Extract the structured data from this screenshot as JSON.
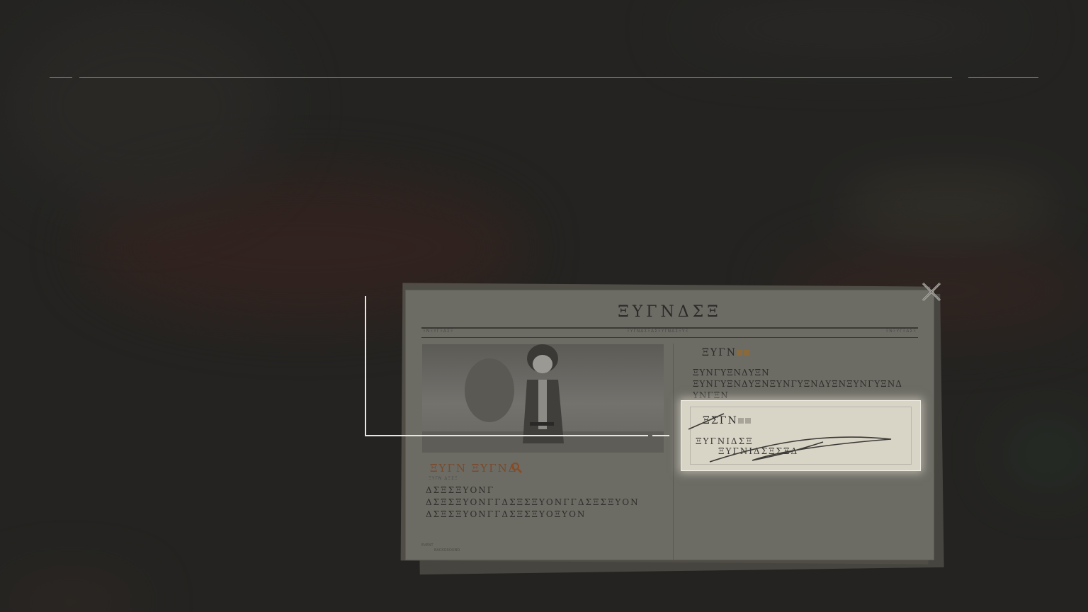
{
  "newspaper": {
    "masthead": "ΞΥΓΝΔΣΞ",
    "masthead_strip": "ΞΥΓΝΔΣΞΔΣΞΥΓΝΔΣΞΥΞ",
    "left_header": "ΞΝΞΥΓΞΔΣΞ",
    "right_header": "ΞΝΞΥΓΞΔΣΞ",
    "left_article": {
      "headline": "ΞΥΓΝ ΞΥΓΝΔ",
      "caption": "ΞΥΓΝ ΔΞΣΞ",
      "lines": [
        "ΔΣΞΣΞΥΟΝΓ",
        "ΔΣΞΣΞΥΟΝΓΓΔΣΞΣΞΥΟΝΓΓΔΣΞΣΞΥΟΝ",
        "ΔΣΞΣΞΥΟΝΓΓΔΣΞΣΞΥΟΞΥΟΝ"
      ],
      "footer_event": "EVENT",
      "footer_background": "BACKGROUND"
    },
    "right_article": {
      "title": "ΞΥΓΝ",
      "lines": [
        "ΞΥΝΓΥΞΝΔΥΞΝ",
        "ΞΥΝΓΥΞΝΔΥΞΝΞΥΝΓΥΞΝΔΥΞΝΞΥΝΓΥΞΝΔ",
        "ΥΝΓΞΝ"
      ]
    },
    "highlighted_clue": {
      "title": "ΞΣΓΝ",
      "line1": "ΞΥΓΝΙΔΣΞ",
      "line2": "ΞΥΓΝΙΔΣΞΣΞΔ"
    }
  },
  "colors": {
    "accent_red": "#7a4a2b",
    "highlight": "#d8d4c6"
  },
  "icons": {
    "close": "close-x-icon",
    "search": "magnifier-icon"
  }
}
